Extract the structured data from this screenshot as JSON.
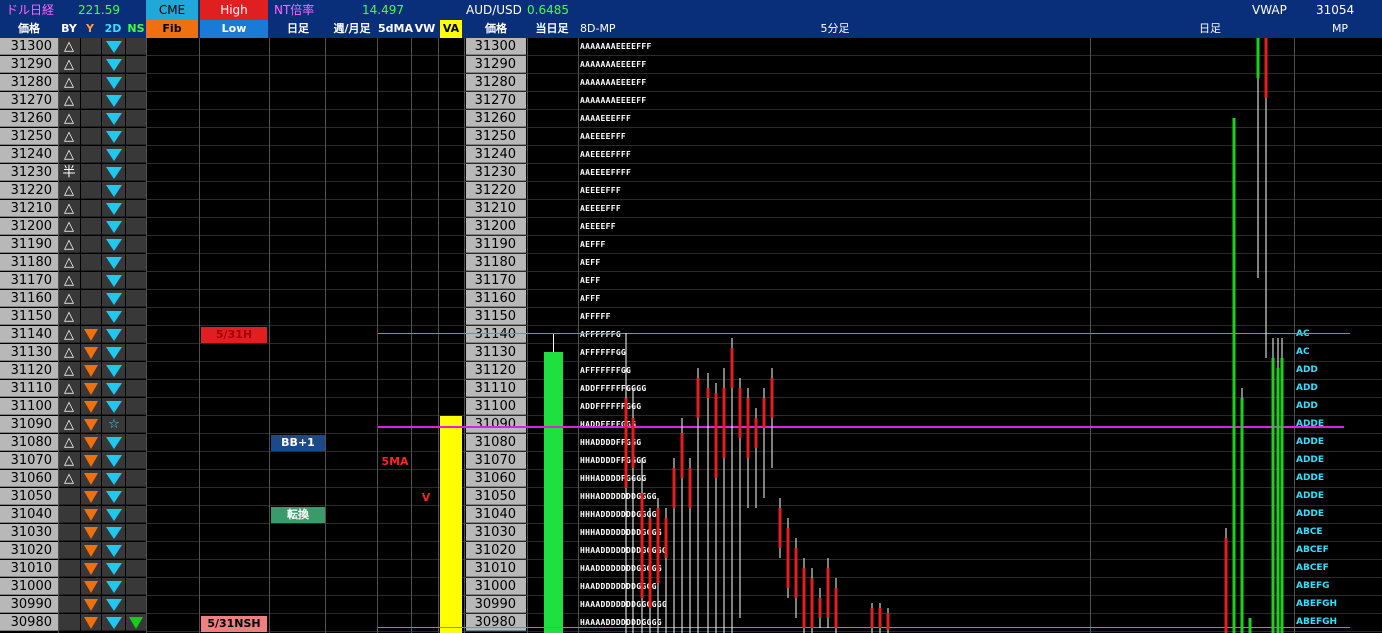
{
  "header": {
    "dollar_nikkei_label": "ドル日経",
    "dollar_nikkei_value": "221.59",
    "cme_label": "CME",
    "high_label": "High",
    "nt_label": "NT倍率",
    "nt_value": "14.497",
    "audusd_label": "AUD/USD",
    "audusd_value": "0.6485",
    "vwap_label": "VWAP",
    "vwap_value": "31054"
  },
  "subheader": {
    "price": "価格",
    "by": "BY",
    "y": "Y",
    "two_d": "2D",
    "ns": "NS",
    "fib": "Fib",
    "low": "Low",
    "daily": "日足",
    "weekly_monthly": "週/月足",
    "fivedma": "5dMA",
    "vw": "VW",
    "va": "VA",
    "price2": "価格",
    "today": "当日足",
    "eightd_mp": "8D-MP",
    "five_min": "5分足",
    "daily2": "日足",
    "mp": "MP"
  },
  "prices": [
    "31300",
    "31290",
    "31280",
    "31270",
    "31260",
    "31250",
    "31240",
    "31230",
    "31220",
    "31210",
    "31200",
    "31190",
    "31180",
    "31170",
    "31160",
    "31150",
    "31140",
    "31130",
    "31120",
    "31110",
    "31100",
    "31090",
    "31080",
    "31070",
    "31060",
    "31050",
    "31040",
    "31030",
    "31020",
    "31010",
    "31000",
    "30990",
    "30980"
  ],
  "by_marks": [
    "△",
    "△",
    "△",
    "△",
    "△",
    "△",
    "△",
    "半",
    "△",
    "△",
    "△",
    "△",
    "△",
    "△",
    "△",
    "△",
    "△",
    "△",
    "△",
    "△",
    "△",
    "△",
    "△",
    "△",
    "△",
    "",
    "",
    "",
    "",
    "",
    "",
    "",
    ""
  ],
  "badges": {
    "d531h": "5/31H",
    "bb1": "BB+1",
    "tenkan": "転換",
    "fivema": "5MA",
    "v": "V",
    "d531nsh": "5/31NSH"
  },
  "mp_letters": [
    "AAAAAAAEEEEFFF",
    "AAAAAAAEEEEFF",
    "AAAAAAAEEEEFF",
    "AAAAAAAEEEEFF",
    "AAAAEEEFFF",
    "AAEEEEFFF",
    "AAEEEEFFFF",
    "AAEEEEFFFF",
    "AEEEEFFF",
    "AEEEEFFF",
    "AEEEEFF",
    "AEFFF",
    "AEFF",
    "AEFF",
    "AFFF",
    "AFFFFF",
    "AFFFFFFG",
    "AFFFFFFGG",
    "AFFFFFFFGG",
    "ADDFFFFFFGGGG",
    "ADDFFFFFFGGG",
    "HADDFFFFGGG",
    "HHADDDDFFGGG",
    "HHADDDDFFGGGG",
    "HHHADDDDFGGGG",
    "HHHADDDDDDDGGGG",
    "HHHADDDDDDDGGGG",
    "HHHADDDDDDDDGGGG",
    "HHAADDDDDDDDGGGGG",
    "HAADDDDDDDDGGGGG",
    "HAADDDDDDDDGGGG",
    "HAAADDDDDDDGGGGGG",
    "HAAAADDDDDDDGGGG"
  ],
  "mp_right": [
    "",
    "",
    "",
    "",
    "",
    "",
    "",
    "",
    "",
    "",
    "",
    "",
    "",
    "",
    "",
    "",
    "AC",
    "AC",
    "ADD",
    "ADD",
    "ADD",
    "ADDE",
    "ADDE",
    "ADDE",
    "ADDE",
    "ADDE",
    "ADDE",
    "ABCE",
    "ABCEF",
    "ABCEF",
    "ABEFG",
    "ABEFGH",
    "ABEFGH"
  ],
  "colors": {
    "header_bg": "#0a2f7a",
    "fib_bg": "#f07010",
    "high_bg": "#e02020",
    "cme_bg": "#20a8d8",
    "va_bg": "#ffff00",
    "green_bar": "#20e040"
  }
}
